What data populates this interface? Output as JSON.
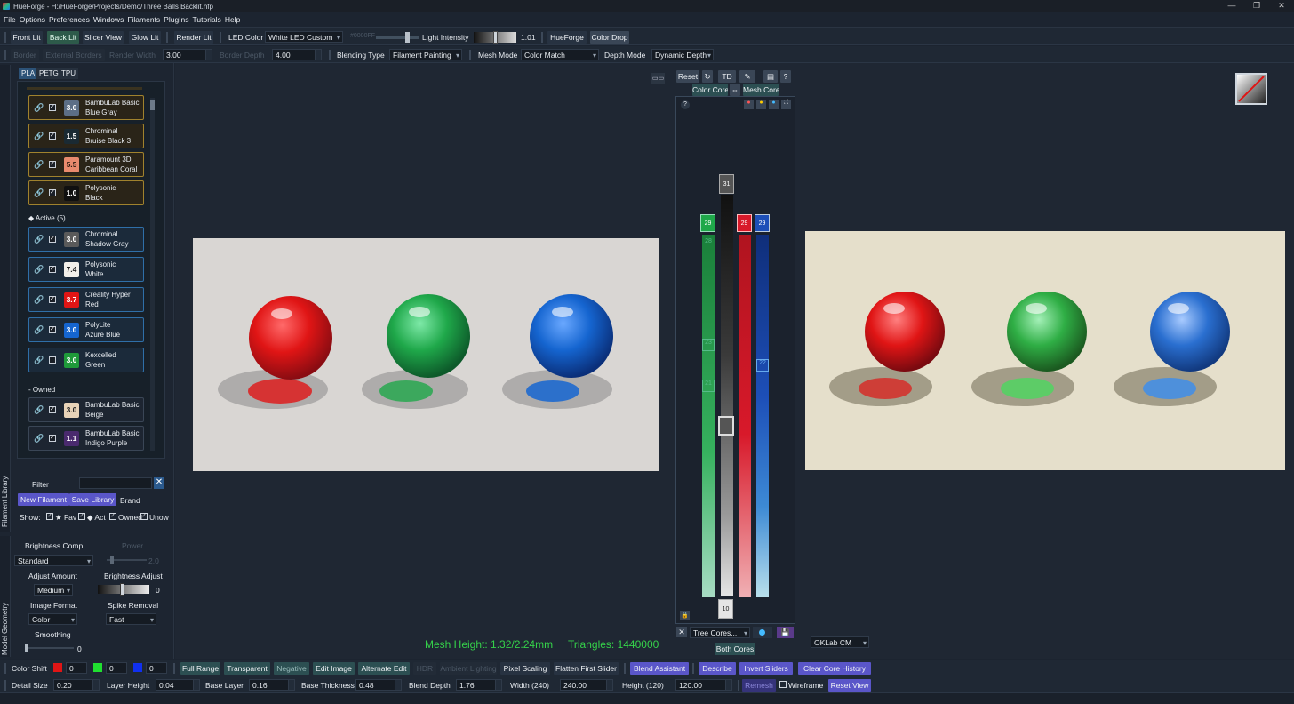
{
  "window": {
    "title": "HueForge - H:/HueForge/Projects/Demo/Three Balls Backlit.hfp",
    "controls": [
      "—",
      "❐",
      "✕"
    ]
  },
  "menu": [
    "File",
    "Options",
    "Preferences",
    "Windows",
    "Filaments",
    "PlugIns",
    "Tutorials",
    "Help"
  ],
  "toolbar1": {
    "front_lit": "Front Lit",
    "back_lit": "Back Lit",
    "slicer_view": "Slicer View",
    "glow_lit": "Glow Lit",
    "render_lit": "Render Lit",
    "led_color_label": "LED Color",
    "led_color_value": "White LED Custom",
    "hex_value": "#0000FF",
    "light_intensity_label": "Light Intensity",
    "light_intensity_value": "1.01",
    "hueforge": "HueForge",
    "color_drop": "Color Drop"
  },
  "toolbar2": {
    "border": "Border",
    "external_borders": "External Borders",
    "render_width_label": "Render Width",
    "render_width_value": "3.00",
    "border_depth_label": "Border Depth",
    "border_depth_value": "4.00",
    "blending_type_label": "Blending Type",
    "blending_type_value": "Filament Painting",
    "mesh_mode_label": "Mesh Mode",
    "mesh_mode_value": "Color Match",
    "depth_mode_label": "Depth Mode",
    "depth_mode_value": "Dynamic Depth"
  },
  "library": {
    "tabs": [
      "PLA",
      "PETG",
      "TPU"
    ],
    "selected_tab": "PLA",
    "top_filaments": [
      {
        "td": "3.0",
        "line1": "BambuLab Basic",
        "line2": "Blue Gray",
        "color": "#5c6e86",
        "text_color": "#ffffff"
      },
      {
        "td": "1.5",
        "line1": "Chrominal",
        "line2": "Bruise Black 3",
        "color": "#1a2a33",
        "text_color": "#ffffff"
      },
      {
        "td": "5.5",
        "line1": "Paramount 3D",
        "line2": "Caribbean Coral",
        "color": "#e98a6e",
        "text_color": "#2a1a10"
      },
      {
        "td": "1.0",
        "line1": "Polysonic",
        "line2": "Black",
        "color": "#101010",
        "text_color": "#ffffff"
      }
    ],
    "active_label": "◆ Active (5)",
    "active_filaments": [
      {
        "td": "3.0",
        "line1": "Chrominal",
        "line2": "Shadow Gray",
        "color": "#5a5a5a",
        "text_color": "#ffffff",
        "checked": "✓"
      },
      {
        "td": "7.4",
        "line1": "Polysonic",
        "line2": "White",
        "color": "#f2efe9",
        "text_color": "#222222",
        "checked": "✓"
      },
      {
        "td": "3.7",
        "line1": "Creality Hyper",
        "line2": "Red",
        "color": "#e01515",
        "text_color": "#ffffff",
        "checked": "✓"
      },
      {
        "td": "3.0",
        "line1": "PolyLite",
        "line2": "Azure Blue",
        "color": "#1565d0",
        "text_color": "#ffffff",
        "checked": "✓"
      },
      {
        "td": "3.0",
        "line1": "Kexcelled",
        "line2": "Green",
        "color": "#1f9a3a",
        "text_color": "#ffffff",
        "checked": ""
      }
    ],
    "owned_label": "- Owned",
    "owned_filaments": [
      {
        "td": "3.0",
        "line1": "BambuLab Basic",
        "line2": "Beige",
        "color": "#e8d3b8",
        "text_color": "#222222"
      },
      {
        "td": "1.1",
        "line1": "BambuLab Basic",
        "line2": "Indigo Purple",
        "color": "#4a2a6e",
        "text_color": "#ffffff"
      }
    ],
    "filter_label": "Filter",
    "filter_value": "",
    "new_filament": "New Filament",
    "save_library": "Save Library",
    "brand": "Brand",
    "show_label": "Show:",
    "show_items": [
      "★ Fav",
      "◆ Act",
      "Owned",
      "Unow"
    ],
    "vertical_tab": "Filament Library"
  },
  "model_geometry": {
    "vertical_tab": "Model Geometry",
    "brightness_comp_label": "Brightness Comp",
    "brightness_comp_value": "Standard",
    "power_label": "Power",
    "power_value": "2.0",
    "adjust_amount_label": "Adjust Amount",
    "adjust_amount_value": "Medium",
    "brightness_adjust_label": "Brightness Adjust",
    "brightness_adjust_value": "0",
    "image_format_label": "Image Format",
    "image_format_value": "Color",
    "spike_removal_label": "Spike Removal",
    "spike_removal_value": "Fast",
    "smoothing_label": "Smoothing",
    "smoothing_value": "0"
  },
  "core_panel": {
    "reset": "Reset",
    "td": "TD",
    "color_core": "Color Core",
    "mesh_core": "Mesh Core",
    "help": "?",
    "sliders": [
      {
        "name": "green",
        "top_label": "29",
        "markers": [
          "28",
          "23",
          "21"
        ],
        "color": "#1fa84a"
      },
      {
        "name": "gray",
        "top_label": "31",
        "bottom_label": "10",
        "color": "#7a7a7a"
      },
      {
        "name": "red",
        "top_label": "29",
        "color": "#d8192a"
      },
      {
        "name": "blue",
        "top_label": "29",
        "markers": [
          "22"
        ],
        "color": "#1d4fb8"
      }
    ],
    "tree_cores": "Tree Cores...",
    "both_cores": "Both Cores"
  },
  "status": {
    "mesh_height": "Mesh Height: 1.32/2.24mm",
    "triangles": "Triangles: 1440000",
    "color_space": "OKLab CM"
  },
  "bottom1": {
    "color_shift": "Color Shift",
    "r": "0",
    "g": "0",
    "b": "0",
    "full_range": "Full Range",
    "transparent": "Transparent",
    "negative": "Negative",
    "edit_image": "Edit Image",
    "alternate_edit": "Alternate Edit",
    "hdr": "HDR",
    "ambient_lighting": "Ambient Lighting",
    "pixel_scaling": "Pixel Scaling",
    "flatten_first_slider": "Flatten First Slider",
    "blend_assistant": "Blend Assistant",
    "describe": "Describe",
    "invert_sliders": "Invert Sliders",
    "clear_core_history": "Clear Core History"
  },
  "bottom2": {
    "detail_size_label": "Detail Size",
    "detail_size_value": "0.20",
    "layer_height_label": "Layer Height",
    "layer_height_value": "0.04",
    "base_layer_label": "Base Layer",
    "base_layer_value": "0.16",
    "base_thickness_label": "Base Thickness",
    "base_thickness_value": "0.48",
    "blend_depth_label": "Blend Depth",
    "blend_depth_value": "1.76",
    "width_label": "Width (240)",
    "width_value": "240.00",
    "height_label": "Height (120)",
    "height_value": "120.00",
    "remesh": "Remesh",
    "wireframe": "Wireframe",
    "reset_view": "Reset View"
  },
  "colors": {
    "accent_purple": "#5a56c9",
    "accent_green": "#2d5a4a",
    "status_green": "#35d24a"
  }
}
